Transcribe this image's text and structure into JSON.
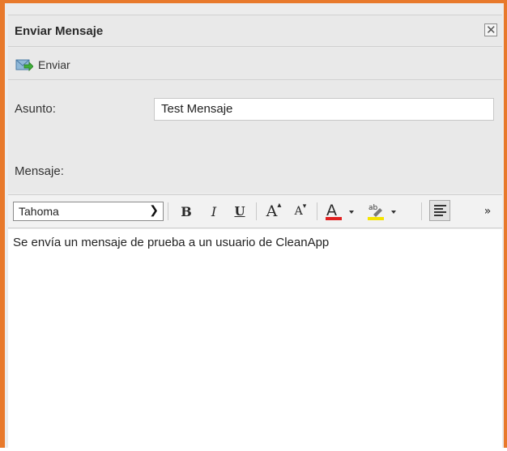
{
  "window": {
    "title": "Enviar Mensaje"
  },
  "toolbar": {
    "send_label": "Enviar"
  },
  "form": {
    "subject_label": "Asunto:",
    "subject_value": "Test Mensaje",
    "message_label": "Mensaje:"
  },
  "editor": {
    "font": "Tahoma",
    "toolbar": {
      "bold": "B",
      "italic": "I",
      "underline": "U",
      "grow": "A",
      "shrink": "A",
      "more": "»"
    },
    "body": "Se envía un mensaje de prueba a un usuario de CleanApp"
  },
  "colors": {
    "accent": "#e8792b",
    "font_color": "#e02020",
    "highlight": "#f5e400"
  }
}
